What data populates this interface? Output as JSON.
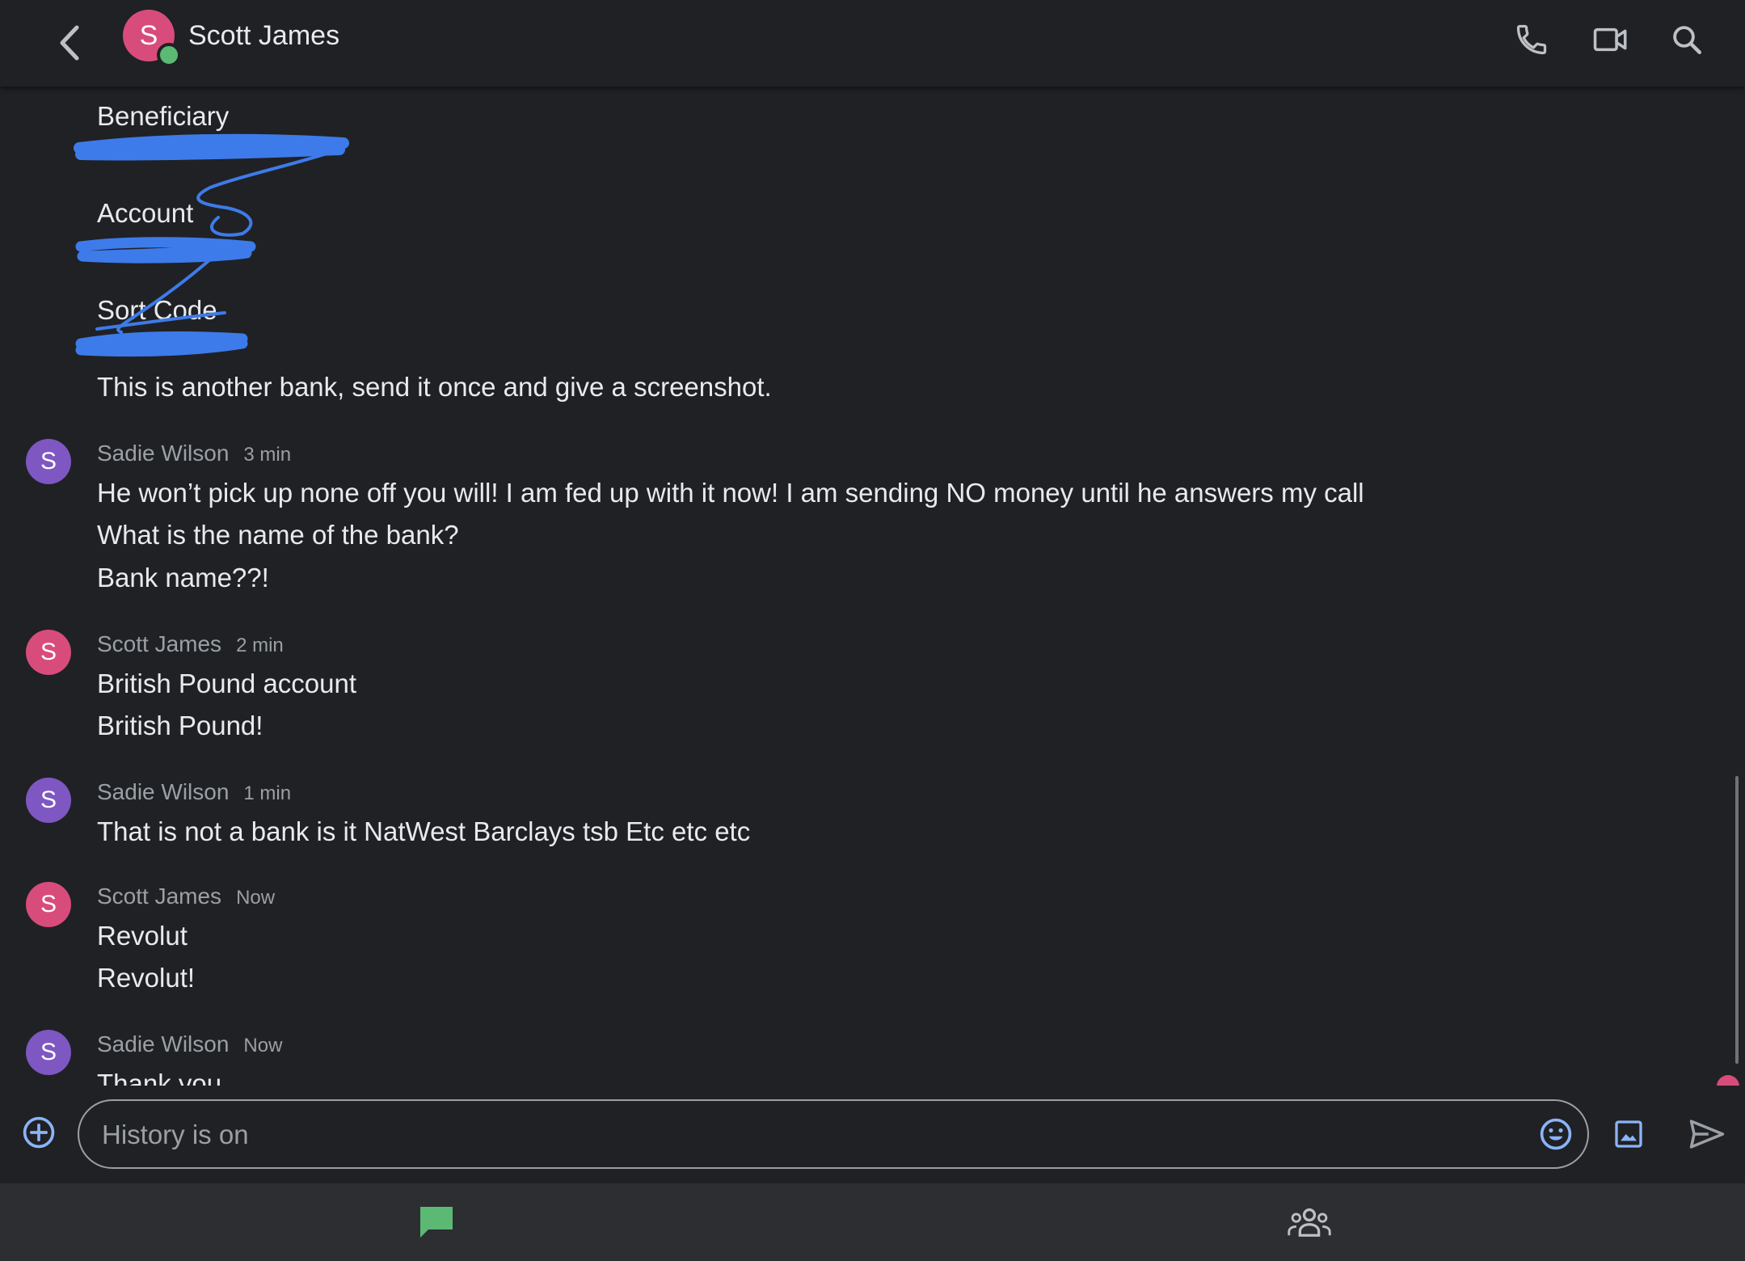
{
  "header": {
    "title": "Scott James",
    "avatar_letter": "S",
    "icons": [
      "back-arrow-icon",
      "phone-icon",
      "video-camera-icon",
      "search-icon"
    ]
  },
  "messages": {
    "partial_top": {
      "labels": [
        "Beneficiary",
        "Account",
        "Sort Code"
      ],
      "text": "This is another bank, send it once and give a screenshot."
    },
    "groups": [
      {
        "sender": "Sadie Wilson",
        "time": "3 min",
        "avatar_letter": "S",
        "lines": [
          "He won’t pick up none off you will! I am fed up with it now! I am sending NO money until he answers my call",
          "What is the name of the bank?",
          "Bank name??!"
        ]
      },
      {
        "sender": "Scott James",
        "time": "2 min",
        "avatar_letter": "S",
        "lines": [
          "British Pound account",
          "British Pound!"
        ]
      },
      {
        "sender": "Sadie Wilson",
        "time": "1 min",
        "avatar_letter": "S",
        "lines": [
          "That is not a bank is it NatWest Barclays tsb Etc etc etc"
        ]
      },
      {
        "sender": "Scott James",
        "time": "Now",
        "avatar_letter": "S",
        "lines": [
          "Revolut",
          "Revolut!"
        ]
      },
      {
        "sender": "Sadie Wilson",
        "time": "Now",
        "avatar_letter": "S",
        "lines": [
          "Thank you"
        ]
      }
    ]
  },
  "composer": {
    "placeholder": "History is on",
    "icons": [
      "add-circle-icon",
      "emoji-icon",
      "image-icon",
      "send-icon"
    ]
  },
  "bottom_nav": {
    "items": [
      "chat-icon",
      "people-icon"
    ],
    "active_color": "#5bb974"
  },
  "colors": {
    "background": "#202124",
    "pink_avatar": "#d84c7b",
    "purple_avatar": "#7e57c2",
    "redaction_blue": "#3d7bea"
  }
}
